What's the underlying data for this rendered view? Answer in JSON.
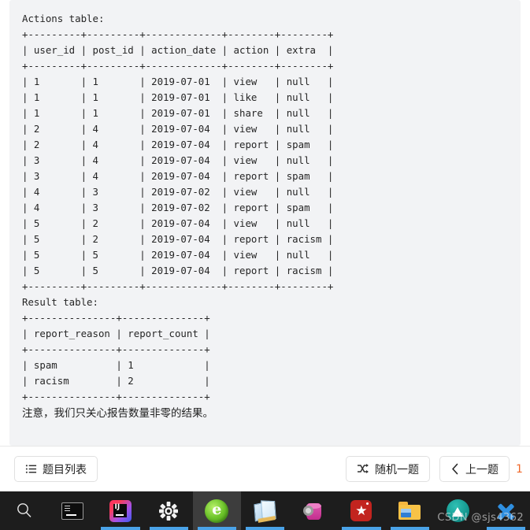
{
  "problem": {
    "actions_label": "Actions table:",
    "actions_block": "Actions table:\n+---------+---------+-------------+--------+--------+\n| user_id | post_id | action_date | action | extra  |\n+---------+---------+-------------+--------+--------+\n| 1       | 1       | 2019-07-01  | view   | null   |\n| 1       | 1       | 2019-07-01  | like   | null   |\n| 1       | 1       | 2019-07-01  | share  | null   |\n| 2       | 4       | 2019-07-04  | view   | null   |\n| 2       | 4       | 2019-07-04  | report | spam   |\n| 3       | 4       | 2019-07-04  | view   | null   |\n| 3       | 4       | 2019-07-04  | report | spam   |\n| 4       | 3       | 2019-07-02  | view   | null   |\n| 4       | 3       | 2019-07-02  | report | spam   |\n| 5       | 2       | 2019-07-04  | view   | null   |\n| 5       | 2       | 2019-07-04  | report | racism |\n| 5       | 5       | 2019-07-04  | view   | null   |\n| 5       | 5       | 2019-07-04  | report | racism |\n+---------+---------+-------------+--------+--------+",
    "result_label": "Result table:",
    "result_block": "Result table:\n+---------------+--------------+\n| report_reason | report_count |\n+---------------+--------------+\n| spam          | 1            |\n| racism        | 2            |\n+---------------+--------------+",
    "note": "注意，我们只关心报告数量非零的结果。",
    "actions_table": {
      "columns": [
        "user_id",
        "post_id",
        "action_date",
        "action",
        "extra"
      ],
      "rows": [
        [
          "1",
          "1",
          "2019-07-01",
          "view",
          "null"
        ],
        [
          "1",
          "1",
          "2019-07-01",
          "like",
          "null"
        ],
        [
          "1",
          "1",
          "2019-07-01",
          "share",
          "null"
        ],
        [
          "2",
          "4",
          "2019-07-04",
          "view",
          "null"
        ],
        [
          "2",
          "4",
          "2019-07-04",
          "report",
          "spam"
        ],
        [
          "3",
          "4",
          "2019-07-04",
          "view",
          "null"
        ],
        [
          "3",
          "4",
          "2019-07-04",
          "report",
          "spam"
        ],
        [
          "4",
          "3",
          "2019-07-02",
          "view",
          "null"
        ],
        [
          "4",
          "3",
          "2019-07-02",
          "report",
          "spam"
        ],
        [
          "5",
          "2",
          "2019-07-04",
          "view",
          "null"
        ],
        [
          "5",
          "2",
          "2019-07-04",
          "report",
          "racism"
        ],
        [
          "5",
          "5",
          "2019-07-04",
          "view",
          "null"
        ],
        [
          "5",
          "5",
          "2019-07-04",
          "report",
          "racism"
        ]
      ]
    },
    "result_table": {
      "columns": [
        "report_reason",
        "report_count"
      ],
      "rows": [
        [
          "spam",
          "1"
        ],
        [
          "racism",
          "2"
        ]
      ]
    }
  },
  "action_bar": {
    "problem_list_label": "题目列表",
    "random_label": "随机一题",
    "prev_label": "上一题",
    "page_number": "1",
    "accent_color": "#f0682a"
  },
  "taskbar": {
    "watermark": "CSDN @sjs4362",
    "items": [
      {
        "name": "search",
        "label": "搜索",
        "running": false,
        "active": false
      },
      {
        "name": "terminal",
        "label": "Terminal",
        "running": false,
        "active": false
      },
      {
        "name": "intellij-idea",
        "label": "IntelliJ IDEA",
        "running": true,
        "active": false
      },
      {
        "name": "settings",
        "label": "设置",
        "running": true,
        "active": false
      },
      {
        "name": "browser-360",
        "label": "360 浏览器",
        "running": true,
        "active": true
      },
      {
        "name": "notepad",
        "label": "记事本",
        "running": true,
        "active": false
      },
      {
        "name": "database",
        "label": "数据库",
        "running": false,
        "active": false
      },
      {
        "name": "star-app",
        "label": "美图",
        "running": true,
        "active": false
      },
      {
        "name": "file-explorer",
        "label": "文件资源管理器",
        "running": true,
        "active": false
      },
      {
        "name": "teal-app",
        "label": "应用",
        "running": false,
        "active": false
      },
      {
        "name": "blue-x-app",
        "label": "关闭",
        "running": true,
        "active": false
      }
    ]
  }
}
